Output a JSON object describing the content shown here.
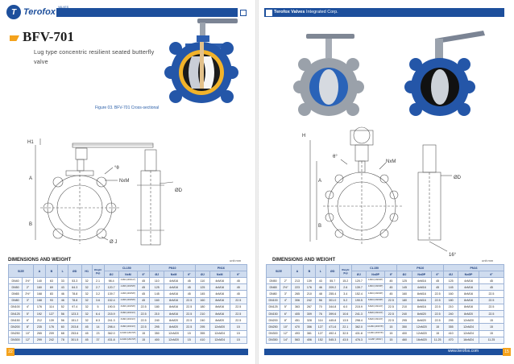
{
  "left_page": {
    "logo_text": "Terofox",
    "logo_super": "VALVES",
    "product_code": "BFV-701",
    "product_desc": "Lug type concentric resilient seated butterfly valve",
    "figure_caption": "Figure 03. BFV-701 Cross-sectional",
    "dims": {
      "h1": "H1",
      "angle": "°θ",
      "nxm": "NxM",
      "od": "ØD",
      "oj": "Ø J",
      "a": "A",
      "b": "B"
    },
    "section_title": "DIMENSIONS AND WEIGHT",
    "unit": "unit:mm",
    "page_number": "22",
    "table": {
      "top_headers": [
        "SIZE",
        "A",
        "B",
        "L",
        "ØD",
        "H1",
        "Weight (Kg)",
        "CL150",
        "PN10",
        "PN16"
      ],
      "sub_headers": [
        "ØJ",
        "NxM",
        "θ°",
        "ØJ",
        "NxM",
        "θ°",
        "ØJ",
        "NxM",
        "θ°"
      ],
      "rows": [
        [
          "DN40",
          "1½\"",
          "140",
          "63",
          "33",
          "53.3",
          "32",
          "2.1",
          "98.4",
          "4-M14 (UNC1/2\")",
          "45",
          "110",
          "4xM16",
          "45",
          "110",
          "4xM16",
          "45"
        ],
        [
          "DN50",
          "2\"",
          "160",
          "69",
          "43",
          "64.3",
          "32",
          "2.7",
          "120.7",
          "4-M16 (UNC5/8\")",
          "45",
          "125",
          "4xM16",
          "45",
          "125",
          "4xM16",
          "45"
        ],
        [
          "DN65",
          "2½\"",
          "168",
          "83",
          "46",
          "78.8",
          "32",
          "3.2",
          "139.7",
          "4-M16 (UNC5/8\")",
          "45",
          "145",
          "4xM16",
          "45",
          "145",
          "4xM16",
          "45"
        ],
        [
          "DN80",
          "3\"",
          "168",
          "93",
          "46",
          "78.8",
          "32",
          "3.6",
          "152.4",
          "4-M16 (UNC5/8\")",
          "45",
          "160",
          "8xM16",
          "22.5",
          "160",
          "8xM16",
          "22.5"
        ],
        [
          "DN100",
          "4\"",
          "176",
          "114",
          "52",
          "97.4",
          "32",
          "5",
          "190.5",
          "8-M16 (UNC5/8\")",
          "22.5",
          "180",
          "8xM16",
          "22.5",
          "180",
          "8xM16",
          "22.5"
        ],
        [
          "DN125",
          "5\"",
          "192",
          "127",
          "56",
          "123.3",
          "32",
          "6.4",
          "215.9",
          "8-M20 (UNC3/4\")",
          "22.5",
          "210",
          "8xM16",
          "22.5",
          "210",
          "8xM16",
          "22.5"
        ],
        [
          "DN150",
          "6\"",
          "212",
          "139",
          "56",
          "151.2",
          "32",
          "8.3",
          "241.3",
          "8-M20 (UNC3/4\")",
          "22.5",
          "240",
          "8xM20",
          "22.5",
          "240",
          "8xM20",
          "22.5"
        ],
        [
          "DN200",
          "8\"",
          "235",
          "176",
          "60",
          "203.8",
          "45",
          "14",
          "298.4",
          "8-M20 (UNC3/4\")",
          "22.5",
          "295",
          "8xM20",
          "22.5",
          "295",
          "12xM20",
          "15"
        ],
        [
          "DN250",
          "10\"",
          "265",
          "209",
          "68",
          "253.6",
          "45",
          "23",
          "362.0",
          "12-M24 (UNC7/8\")",
          "15",
          "350",
          "12xM20",
          "15",
          "355",
          "12xM24",
          "15"
        ],
        [
          "DN300",
          "12\"",
          "299",
          "242",
          "78",
          "301.5",
          "45",
          "37",
          "431.8",
          "12-M24 (UNC7/8\")",
          "15",
          "400",
          "12xM20",
          "15",
          "410",
          "12xM24",
          "15"
        ]
      ]
    }
  },
  "right_page": {
    "header_brand": "Terofox Valves",
    "header_rest": " Integrated Corp.",
    "dims": {
      "h": "H",
      "angle": "θ°",
      "nxm": "NxM",
      "od": "ØD",
      "a": "A",
      "b": "B",
      "deg": "16°"
    },
    "section_title": "DIMENSIONS AND WEIGHT",
    "unit": "unit:mm",
    "website": "www.terofox.com",
    "page_number": "15",
    "table": {
      "top_headers": [
        "SIZE",
        "A",
        "B",
        "L",
        "ØD",
        "Weight (Kg)",
        "CL150",
        "PN10",
        "PN16"
      ],
      "sub_headers": [
        "ØJ",
        "NxØP",
        "θ°",
        "ØJ",
        "NxØP",
        "θ°",
        "ØJ",
        "NxØP",
        "θ°"
      ],
      "rows": [
        [
          "DN50",
          "2\"",
          "213",
          "139",
          "43",
          "55.7",
          "15.2",
          "120.7",
          "4-M16 (UNC5/8\")",
          "45",
          "125",
          "4xM16",
          "45",
          "125",
          "4xM16",
          "45"
        ],
        [
          "DN65",
          "2½\"",
          "223",
          "176",
          "46",
          "209.2",
          "2.6",
          "139.7",
          "4-M16 (UNC5/8\")",
          "45",
          "145",
          "4xM16",
          "45",
          "145",
          "4xM16",
          "45"
        ],
        [
          "DN80",
          "3\"",
          "265",
          "210",
          "48",
          "255.4",
          "3.4",
          "152.4",
          "4-M16 (UNC5/8\")",
          "45",
          "160",
          "8xM16",
          "22.5",
          "160",
          "8xM16",
          "22.5"
        ],
        [
          "DN100",
          "4\"",
          "306",
          "242",
          "56",
          "301.0",
          "5.2",
          "190.5",
          "8-M16 (UNC5/8\")",
          "22.5",
          "180",
          "8xM16",
          "22.5",
          "180",
          "8xM16",
          "22.5"
        ],
        [
          "DN125",
          "5\"",
          "363",
          "267",
          "70",
          "344.8",
          "6.0",
          "215.9",
          "8-M20 (UNC3/4\")",
          "22.5",
          "210",
          "8xM16",
          "22.5",
          "210",
          "8xM16",
          "22.5"
        ],
        [
          "DN150",
          "6\"",
          "405",
          "309",
          "76",
          "399.6",
          "10.6",
          "241.3",
          "8-M20 (UNC3/4\")",
          "22.5",
          "240",
          "8xM20",
          "22.5",
          "240",
          "8xM20",
          "22.5"
        ],
        [
          "DN200",
          "8\"",
          "451",
          "328",
          "114",
          "445.8",
          "13.5",
          "298.4",
          "8-M20 (UNC3/4\")",
          "22.5",
          "295",
          "8xM20",
          "22.5",
          "295",
          "12xM20",
          "15"
        ],
        [
          "DN250",
          "10\"",
          "470",
          "356",
          "127",
          "471.6",
          "22.1",
          "362.0",
          "12-M24 (UNC7/8\")",
          "15",
          "350",
          "12xM20",
          "15",
          "355",
          "12xM24",
          "15"
        ],
        [
          "DN300",
          "12\"",
          "493",
          "381",
          "127",
          "492.4",
          "32.5",
          "431.8",
          "12-M24 (UNC7/8\")",
          "15",
          "400",
          "12xM20",
          "15",
          "410",
          "12xM24",
          "15"
        ],
        [
          "DN350",
          "14\"",
          "563",
          "406",
          "152",
          "545.3",
          "43.5",
          "476.3",
          "12-M27 (UNC1\")",
          "15",
          "460",
          "16xM20",
          "11.25",
          "470",
          "16xM24",
          "11.25"
        ]
      ]
    }
  }
}
